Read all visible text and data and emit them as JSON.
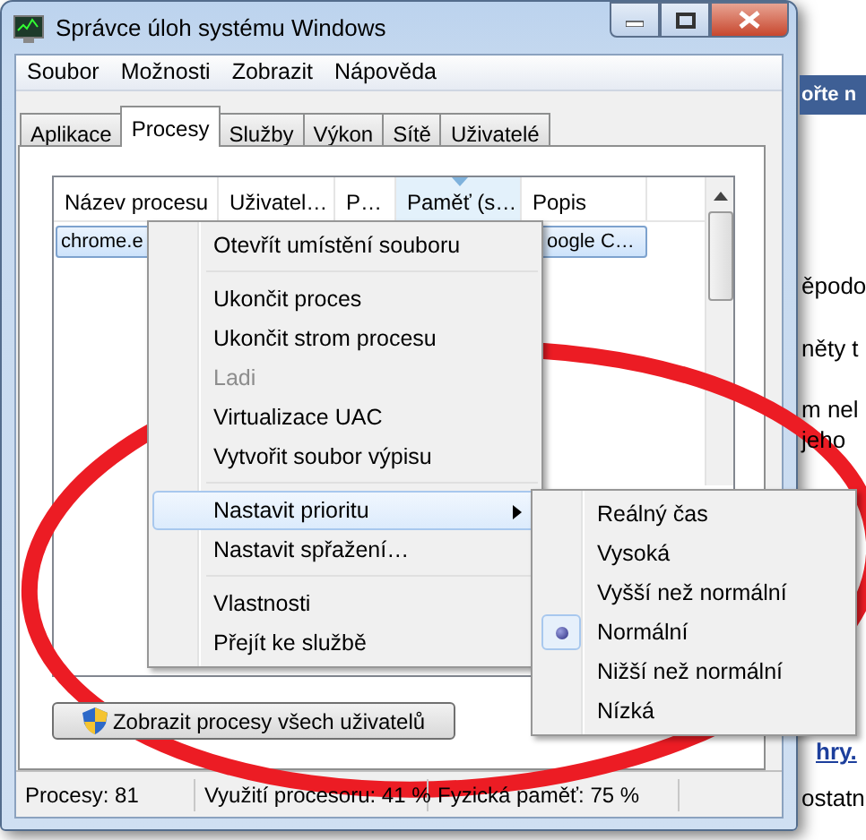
{
  "window": {
    "title": "Správce úloh systému Windows"
  },
  "menu_bar": [
    "Soubor",
    "Možnosti",
    "Zobrazit",
    "Nápověda"
  ],
  "tabs": [
    {
      "label": "Aplikace",
      "selected": false
    },
    {
      "label": "Procesy",
      "selected": true
    },
    {
      "label": "Služby",
      "selected": false
    },
    {
      "label": "Výkon",
      "selected": false
    },
    {
      "label": "Sítě",
      "selected": false
    },
    {
      "label": "Uživatelé",
      "selected": false
    }
  ],
  "table": {
    "columns": [
      {
        "label": "Název procesu",
        "sorted": false
      },
      {
        "label": "Uživatel…",
        "sorted": false
      },
      {
        "label": "P…",
        "sorted": false
      },
      {
        "label": "Paměť (s…",
        "sorted": true
      },
      {
        "label": "Popis",
        "sorted": false
      }
    ],
    "rows": [
      {
        "cells": [
          "chrome.e",
          "",
          "",
          "",
          "oogle C…"
        ],
        "selected": true
      }
    ]
  },
  "context_menu": [
    {
      "kind": "item",
      "label": "Otevřít umístění souboru",
      "disabled": false,
      "highlighted": false,
      "submenu": false
    },
    {
      "kind": "separator"
    },
    {
      "kind": "item",
      "label": "Ukončit proces",
      "disabled": false,
      "highlighted": false,
      "submenu": false
    },
    {
      "kind": "item",
      "label": "Ukončit strom procesu",
      "disabled": false,
      "highlighted": false,
      "submenu": false
    },
    {
      "kind": "item",
      "label": "Ladi",
      "disabled": true,
      "highlighted": false,
      "submenu": false
    },
    {
      "kind": "item",
      "label": "Virtualizace UAC",
      "disabled": false,
      "highlighted": false,
      "submenu": false
    },
    {
      "kind": "item",
      "label": "Vytvořit soubor výpisu",
      "disabled": false,
      "highlighted": false,
      "submenu": false
    },
    {
      "kind": "separator"
    },
    {
      "kind": "item",
      "label": "Nastavit prioritu",
      "disabled": false,
      "highlighted": true,
      "submenu": true
    },
    {
      "kind": "item",
      "label": "Nastavit spřažení…",
      "disabled": false,
      "highlighted": false,
      "submenu": false
    },
    {
      "kind": "separator"
    },
    {
      "kind": "item",
      "label": "Vlastnosti",
      "disabled": false,
      "highlighted": false,
      "submenu": false
    },
    {
      "kind": "item",
      "label": "Přejít ke službě",
      "disabled": false,
      "highlighted": false,
      "submenu": false
    }
  ],
  "priority_submenu": [
    {
      "label": "Reálný čas",
      "selected": false
    },
    {
      "label": "Vysoká",
      "selected": false
    },
    {
      "label": "Vyšší než normální",
      "selected": false
    },
    {
      "label": "Normální",
      "selected": true
    },
    {
      "label": "Nižší než normální",
      "selected": false
    },
    {
      "label": "Nízká",
      "selected": false
    }
  ],
  "show_all_button": {
    "label": "Zobrazit procesy všech uživatelů"
  },
  "status_bar": [
    "Procesy: 81",
    "Využití procesoru: 41 %",
    "Fyzická paměť: 75 %"
  ],
  "background_page": [
    {
      "kind": "banner",
      "text": "ořte n"
    },
    {
      "kind": "text",
      "text": "ěpodo"
    },
    {
      "kind": "text",
      "text": "něty t"
    },
    {
      "kind": "text",
      "text": "m nel"
    },
    {
      "kind": "text",
      "text": "jeho"
    },
    {
      "kind": "link",
      "text": "hry."
    },
    {
      "kind": "text",
      "text": "ostatn"
    }
  ]
}
